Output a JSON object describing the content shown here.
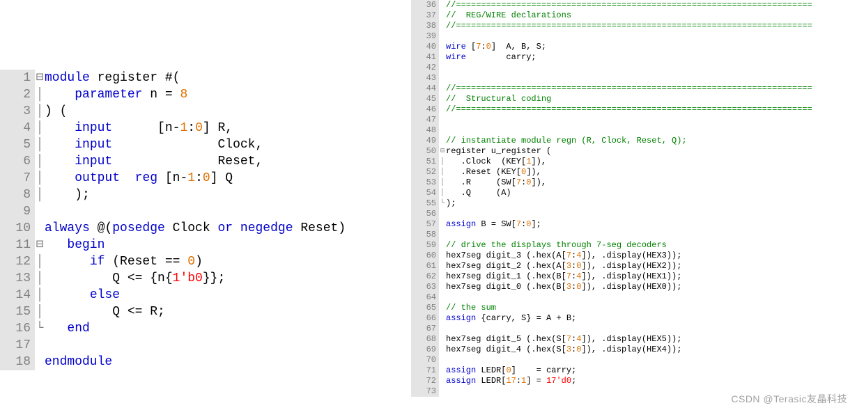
{
  "watermark": "CSDN @Terasic友晶科技",
  "left": {
    "fontSize": "large",
    "startLine": 1,
    "lines": [
      {
        "n": 1,
        "fold": "⊟",
        "tokens": [
          [
            "kw",
            "module"
          ],
          [
            "",
            " register #("
          ]
        ]
      },
      {
        "n": 2,
        "fold": "│",
        "tokens": [
          [
            "",
            "    "
          ],
          [
            "kw",
            "parameter"
          ],
          [
            "",
            " n = "
          ],
          [
            "num",
            "8"
          ]
        ]
      },
      {
        "n": 3,
        "fold": "│",
        "tokens": [
          [
            "",
            ") ("
          ]
        ]
      },
      {
        "n": 4,
        "fold": "│",
        "tokens": [
          [
            "",
            "    "
          ],
          [
            "kw",
            "input"
          ],
          [
            "",
            "      [n-"
          ],
          [
            "num",
            "1"
          ],
          [
            "",
            ":"
          ],
          [
            "num",
            "0"
          ],
          [
            "",
            "] R,"
          ]
        ]
      },
      {
        "n": 5,
        "fold": "│",
        "tokens": [
          [
            "",
            "    "
          ],
          [
            "kw",
            "input"
          ],
          [
            "",
            "              Clock,"
          ]
        ]
      },
      {
        "n": 6,
        "fold": "│",
        "tokens": [
          [
            "",
            "    "
          ],
          [
            "kw",
            "input"
          ],
          [
            "",
            "              Reset,"
          ]
        ]
      },
      {
        "n": 7,
        "fold": "│",
        "tokens": [
          [
            "",
            "    "
          ],
          [
            "kw",
            "output"
          ],
          [
            "",
            "  "
          ],
          [
            "kw",
            "reg"
          ],
          [
            "",
            " [n-"
          ],
          [
            "num",
            "1"
          ],
          [
            "",
            ":"
          ],
          [
            "num",
            "0"
          ],
          [
            "",
            "] Q"
          ]
        ]
      },
      {
        "n": 8,
        "fold": "│",
        "tokens": [
          [
            "",
            "    );"
          ]
        ]
      },
      {
        "n": 9,
        "fold": " ",
        "tokens": [
          [
            "",
            ""
          ]
        ]
      },
      {
        "n": 10,
        "fold": " ",
        "tokens": [
          [
            "kw",
            "always"
          ],
          [
            "",
            " @("
          ],
          [
            "kw",
            "posedge"
          ],
          [
            "",
            " Clock "
          ],
          [
            "kw",
            "or"
          ],
          [
            "",
            " "
          ],
          [
            "kw",
            "negedge"
          ],
          [
            "",
            " Reset)"
          ]
        ]
      },
      {
        "n": 11,
        "fold": "⊟",
        "tokens": [
          [
            "",
            "   "
          ],
          [
            "kw",
            "begin"
          ]
        ]
      },
      {
        "n": 12,
        "fold": "│",
        "tokens": [
          [
            "",
            "      "
          ],
          [
            "kw",
            "if"
          ],
          [
            "",
            " (Reset == "
          ],
          [
            "num",
            "0"
          ],
          [
            "",
            ")"
          ]
        ]
      },
      {
        "n": 13,
        "fold": "│",
        "tokens": [
          [
            "",
            "         Q <= {n{"
          ],
          [
            "str",
            "1'b0"
          ],
          [
            "",
            "}};"
          ]
        ]
      },
      {
        "n": 14,
        "fold": "│",
        "tokens": [
          [
            "",
            "      "
          ],
          [
            "kw",
            "else"
          ]
        ]
      },
      {
        "n": 15,
        "fold": "│",
        "tokens": [
          [
            "",
            "         Q <= R;"
          ]
        ]
      },
      {
        "n": 16,
        "fold": "└",
        "tokens": [
          [
            "",
            "   "
          ],
          [
            "kw",
            "end"
          ]
        ]
      },
      {
        "n": 17,
        "fold": " ",
        "tokens": [
          [
            "",
            ""
          ]
        ]
      },
      {
        "n": 18,
        "fold": " ",
        "tokens": [
          [
            "kw",
            "endmodule"
          ]
        ]
      }
    ]
  },
  "right": {
    "fontSize": "small",
    "startLine": 36,
    "lines": [
      {
        "n": 36,
        "fold": " ",
        "tokens": [
          [
            "com",
            "//======================================================================="
          ]
        ]
      },
      {
        "n": 37,
        "fold": " ",
        "tokens": [
          [
            "com",
            "//  REG/WIRE declarations"
          ]
        ]
      },
      {
        "n": 38,
        "fold": " ",
        "tokens": [
          [
            "com",
            "//======================================================================="
          ]
        ]
      },
      {
        "n": 39,
        "fold": " ",
        "tokens": [
          [
            "",
            ""
          ]
        ]
      },
      {
        "n": 40,
        "fold": " ",
        "tokens": [
          [
            "kw",
            "wire"
          ],
          [
            "",
            " ["
          ],
          [
            "num",
            "7"
          ],
          [
            "",
            ":"
          ],
          [
            "num",
            "0"
          ],
          [
            "",
            "]  A, B, S;"
          ]
        ]
      },
      {
        "n": 41,
        "fold": " ",
        "tokens": [
          [
            "kw",
            "wire"
          ],
          [
            "",
            "        carry;"
          ]
        ]
      },
      {
        "n": 42,
        "fold": " ",
        "tokens": [
          [
            "",
            ""
          ]
        ]
      },
      {
        "n": 43,
        "fold": " ",
        "tokens": [
          [
            "",
            ""
          ]
        ]
      },
      {
        "n": 44,
        "fold": " ",
        "tokens": [
          [
            "com",
            "//======================================================================="
          ]
        ]
      },
      {
        "n": 45,
        "fold": " ",
        "tokens": [
          [
            "com",
            "//  Structural coding"
          ]
        ]
      },
      {
        "n": 46,
        "fold": " ",
        "tokens": [
          [
            "com",
            "//======================================================================="
          ]
        ]
      },
      {
        "n": 47,
        "fold": " ",
        "tokens": [
          [
            "",
            ""
          ]
        ]
      },
      {
        "n": 48,
        "fold": " ",
        "tokens": [
          [
            "",
            ""
          ]
        ]
      },
      {
        "n": 49,
        "fold": " ",
        "tokens": [
          [
            "com",
            "// instantiate module regn (R, Clock, Reset, Q);"
          ]
        ]
      },
      {
        "n": 50,
        "fold": "⊟",
        "tokens": [
          [
            "",
            "register u_register ("
          ]
        ]
      },
      {
        "n": 51,
        "fold": "│",
        "tokens": [
          [
            "",
            "   .Clock  (KEY["
          ],
          [
            "num",
            "1"
          ],
          [
            "",
            "]),"
          ]
        ]
      },
      {
        "n": 52,
        "fold": "│",
        "tokens": [
          [
            "",
            "   .Reset (KEY["
          ],
          [
            "num",
            "0"
          ],
          [
            "",
            "]),"
          ]
        ]
      },
      {
        "n": 53,
        "fold": "│",
        "tokens": [
          [
            "",
            "   .R     (SW["
          ],
          [
            "num",
            "7"
          ],
          [
            "",
            ":"
          ],
          [
            "num",
            "0"
          ],
          [
            "",
            "]),"
          ]
        ]
      },
      {
        "n": 54,
        "fold": "│",
        "tokens": [
          [
            "",
            "   .Q     (A)"
          ]
        ]
      },
      {
        "n": 55,
        "fold": "└",
        "tokens": [
          [
            "",
            ");"
          ]
        ]
      },
      {
        "n": 56,
        "fold": " ",
        "tokens": [
          [
            "",
            ""
          ]
        ]
      },
      {
        "n": 57,
        "fold": " ",
        "tokens": [
          [
            "kw",
            "assign"
          ],
          [
            "",
            " B = SW["
          ],
          [
            "num",
            "7"
          ],
          [
            "",
            ":"
          ],
          [
            "num",
            "0"
          ],
          [
            "",
            "];"
          ]
        ]
      },
      {
        "n": 58,
        "fold": " ",
        "tokens": [
          [
            "",
            ""
          ]
        ]
      },
      {
        "n": 59,
        "fold": " ",
        "tokens": [
          [
            "com",
            "// drive the displays through 7-seg decoders"
          ]
        ]
      },
      {
        "n": 60,
        "fold": " ",
        "tokens": [
          [
            "",
            "hex7seg digit_3 (.hex(A["
          ],
          [
            "num",
            "7"
          ],
          [
            "",
            ":"
          ],
          [
            "num",
            "4"
          ],
          [
            "",
            "]), .display(HEX3));"
          ]
        ]
      },
      {
        "n": 61,
        "fold": " ",
        "tokens": [
          [
            "",
            "hex7seg digit_2 (.hex(A["
          ],
          [
            "num",
            "3"
          ],
          [
            "",
            ":"
          ],
          [
            "num",
            "0"
          ],
          [
            "",
            "]), .display(HEX2));"
          ]
        ]
      },
      {
        "n": 62,
        "fold": " ",
        "tokens": [
          [
            "",
            "hex7seg digit_1 (.hex(B["
          ],
          [
            "num",
            "7"
          ],
          [
            "",
            ":"
          ],
          [
            "num",
            "4"
          ],
          [
            "",
            "]), .display(HEX1));"
          ]
        ]
      },
      {
        "n": 63,
        "fold": " ",
        "tokens": [
          [
            "",
            "hex7seg digit_0 (.hex(B["
          ],
          [
            "num",
            "3"
          ],
          [
            "",
            ":"
          ],
          [
            "num",
            "0"
          ],
          [
            "",
            "]), .display(HEX0));"
          ]
        ]
      },
      {
        "n": 64,
        "fold": " ",
        "tokens": [
          [
            "",
            ""
          ]
        ]
      },
      {
        "n": 65,
        "fold": " ",
        "tokens": [
          [
            "com",
            "// the sum"
          ]
        ]
      },
      {
        "n": 66,
        "fold": " ",
        "tokens": [
          [
            "kw",
            "assign"
          ],
          [
            "",
            " {carry, S} = A + B;"
          ]
        ]
      },
      {
        "n": 67,
        "fold": " ",
        "tokens": [
          [
            "",
            ""
          ]
        ]
      },
      {
        "n": 68,
        "fold": " ",
        "tokens": [
          [
            "",
            "hex7seg digit_5 (.hex(S["
          ],
          [
            "num",
            "7"
          ],
          [
            "",
            ":"
          ],
          [
            "num",
            "4"
          ],
          [
            "",
            "]), .display(HEX5));"
          ]
        ]
      },
      {
        "n": 69,
        "fold": " ",
        "tokens": [
          [
            "",
            "hex7seg digit_4 (.hex(S["
          ],
          [
            "num",
            "3"
          ],
          [
            "",
            ":"
          ],
          [
            "num",
            "0"
          ],
          [
            "",
            "]), .display(HEX4));"
          ]
        ]
      },
      {
        "n": 70,
        "fold": " ",
        "tokens": [
          [
            "",
            ""
          ]
        ]
      },
      {
        "n": 71,
        "fold": " ",
        "tokens": [
          [
            "kw",
            "assign"
          ],
          [
            "",
            " LEDR["
          ],
          [
            "num",
            "0"
          ],
          [
            "",
            "]    = carry;"
          ]
        ]
      },
      {
        "n": 72,
        "fold": " ",
        "tokens": [
          [
            "kw",
            "assign"
          ],
          [
            "",
            " LEDR["
          ],
          [
            "num",
            "17"
          ],
          [
            "",
            ":"
          ],
          [
            "num",
            "1"
          ],
          [
            "",
            "] = "
          ],
          [
            "str",
            "17'd0"
          ],
          [
            "",
            ";"
          ]
        ]
      },
      {
        "n": 73,
        "fold": " ",
        "tokens": [
          [
            "",
            ""
          ]
        ]
      }
    ]
  }
}
